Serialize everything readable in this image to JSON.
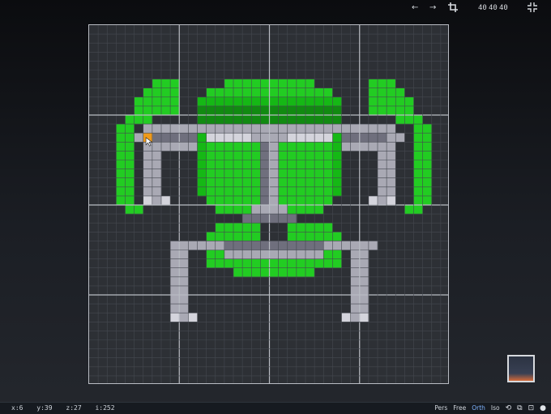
{
  "toolbar": {
    "undo_glyph": "←",
    "redo_glyph": "→",
    "crop_icon": "crop-icon",
    "size_x": "40",
    "size_y": "40",
    "size_z": "40",
    "fullscreen_icon": "collapse-icon"
  },
  "voxel_art": {
    "grid_size": 40,
    "colors": {
      "background": "#2d3035",
      "grid_line": "#454950",
      "major_grid": "#b9bcc3",
      "bright_green": "#22cc22",
      "dark_green": "#118a11",
      "outline_green": "#15b815",
      "grey": "#a9a9b4",
      "light_grey": "#d4d4dc",
      "dark_grey": "#6f6f7d",
      "cursor_orange": "#f09a1a"
    },
    "selected_voxel": {
      "col": 6,
      "row": 12
    }
  },
  "status": {
    "x": "x:6",
    "y": "y:39",
    "z": "z:27",
    "i": "i:252"
  },
  "view_modes": {
    "pers": "Pers",
    "free": "Free",
    "orth": "Orth",
    "iso": "Iso"
  },
  "preview": {
    "label": ""
  }
}
